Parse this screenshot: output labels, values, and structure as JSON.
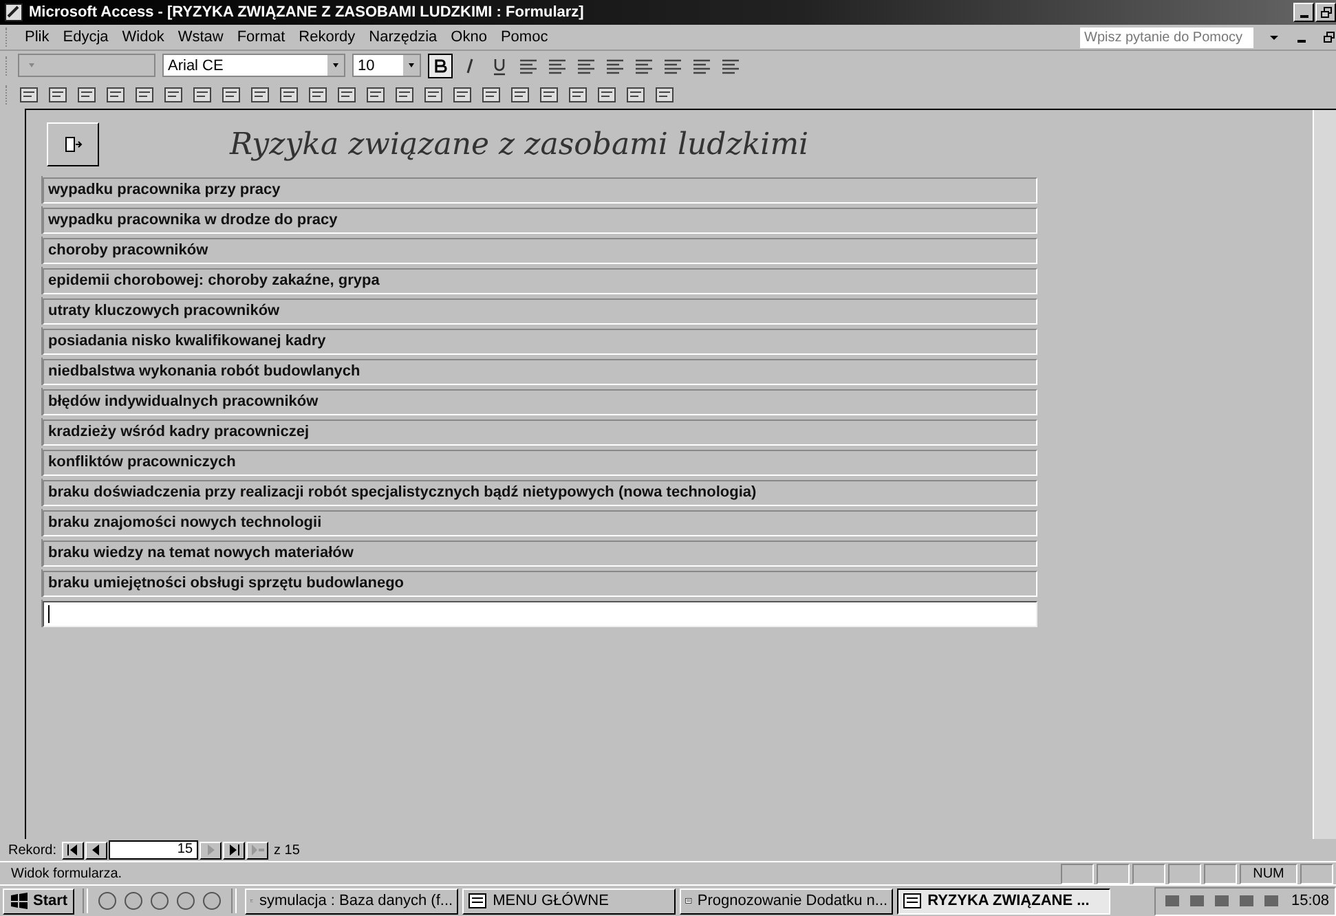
{
  "window": {
    "title": "Microsoft Access - [RYZYKA ZWIĄZANE Z ZASOBAMI LUDZKIMI : Formularz]"
  },
  "menu": [
    "Plik",
    "Edycja",
    "Widok",
    "Wstaw",
    "Format",
    "Rekordy",
    "Narzędzia",
    "Okno",
    "Pomoc"
  ],
  "help": {
    "placeholder": "Wpisz pytanie do Pomocy"
  },
  "format_toolbar": {
    "font": "Arial CE",
    "size": "10",
    "bold": true
  },
  "form": {
    "title": "Ryzyka związane z zasobami ludzkimi",
    "records": [
      {
        "text": "wypadku pracownika przy pracy",
        "current": false
      },
      {
        "text": "wypadku pracownika w drodze do pracy",
        "current": false
      },
      {
        "text": "choroby pracowników",
        "current": false
      },
      {
        "text": "epidemii chorobowej: choroby zakaźne, grypa",
        "current": false
      },
      {
        "text": "utraty kluczowych pracowników",
        "current": false
      },
      {
        "text": "posiadania nisko kwalifikowanej kadry",
        "current": false
      },
      {
        "text": "niedbalstwa wykonania robót budowlanych",
        "current": false
      },
      {
        "text": "błędów indywidualnych pracowników",
        "current": false
      },
      {
        "text": "kradzieży wśród kadry pracowniczej",
        "current": false
      },
      {
        "text": "konfliktów pracowniczych",
        "current": false
      },
      {
        "text": "braku doświadczenia przy realizacji robót specjalistycznych bądź nietypowych (nowa technologia)",
        "current": false
      },
      {
        "text": "braku znajomości nowych technologii",
        "current": false
      },
      {
        "text": "braku wiedzy na temat nowych materiałów",
        "current": false
      },
      {
        "text": "braku  umiejętności obsługi sprzętu budowlanego",
        "current": false
      },
      {
        "current": true
      }
    ]
  },
  "navigator": {
    "label": "Rekord:",
    "record": "15",
    "total": "z 15"
  },
  "status_bar": {
    "text": "Widok formularza.",
    "indicator": "NUM"
  },
  "taskbar": {
    "start": "Start",
    "tasks": [
      {
        "label": "symulacja : Baza danych (f...",
        "selected": false
      },
      {
        "label": "MENU GŁÓWNE",
        "selected": false
      },
      {
        "label": "Prognozowanie Dodatku n...",
        "selected": false
      },
      {
        "label": "RYZYKA ZWIĄZANE ...",
        "selected": true
      }
    ],
    "clock": "15:08"
  }
}
